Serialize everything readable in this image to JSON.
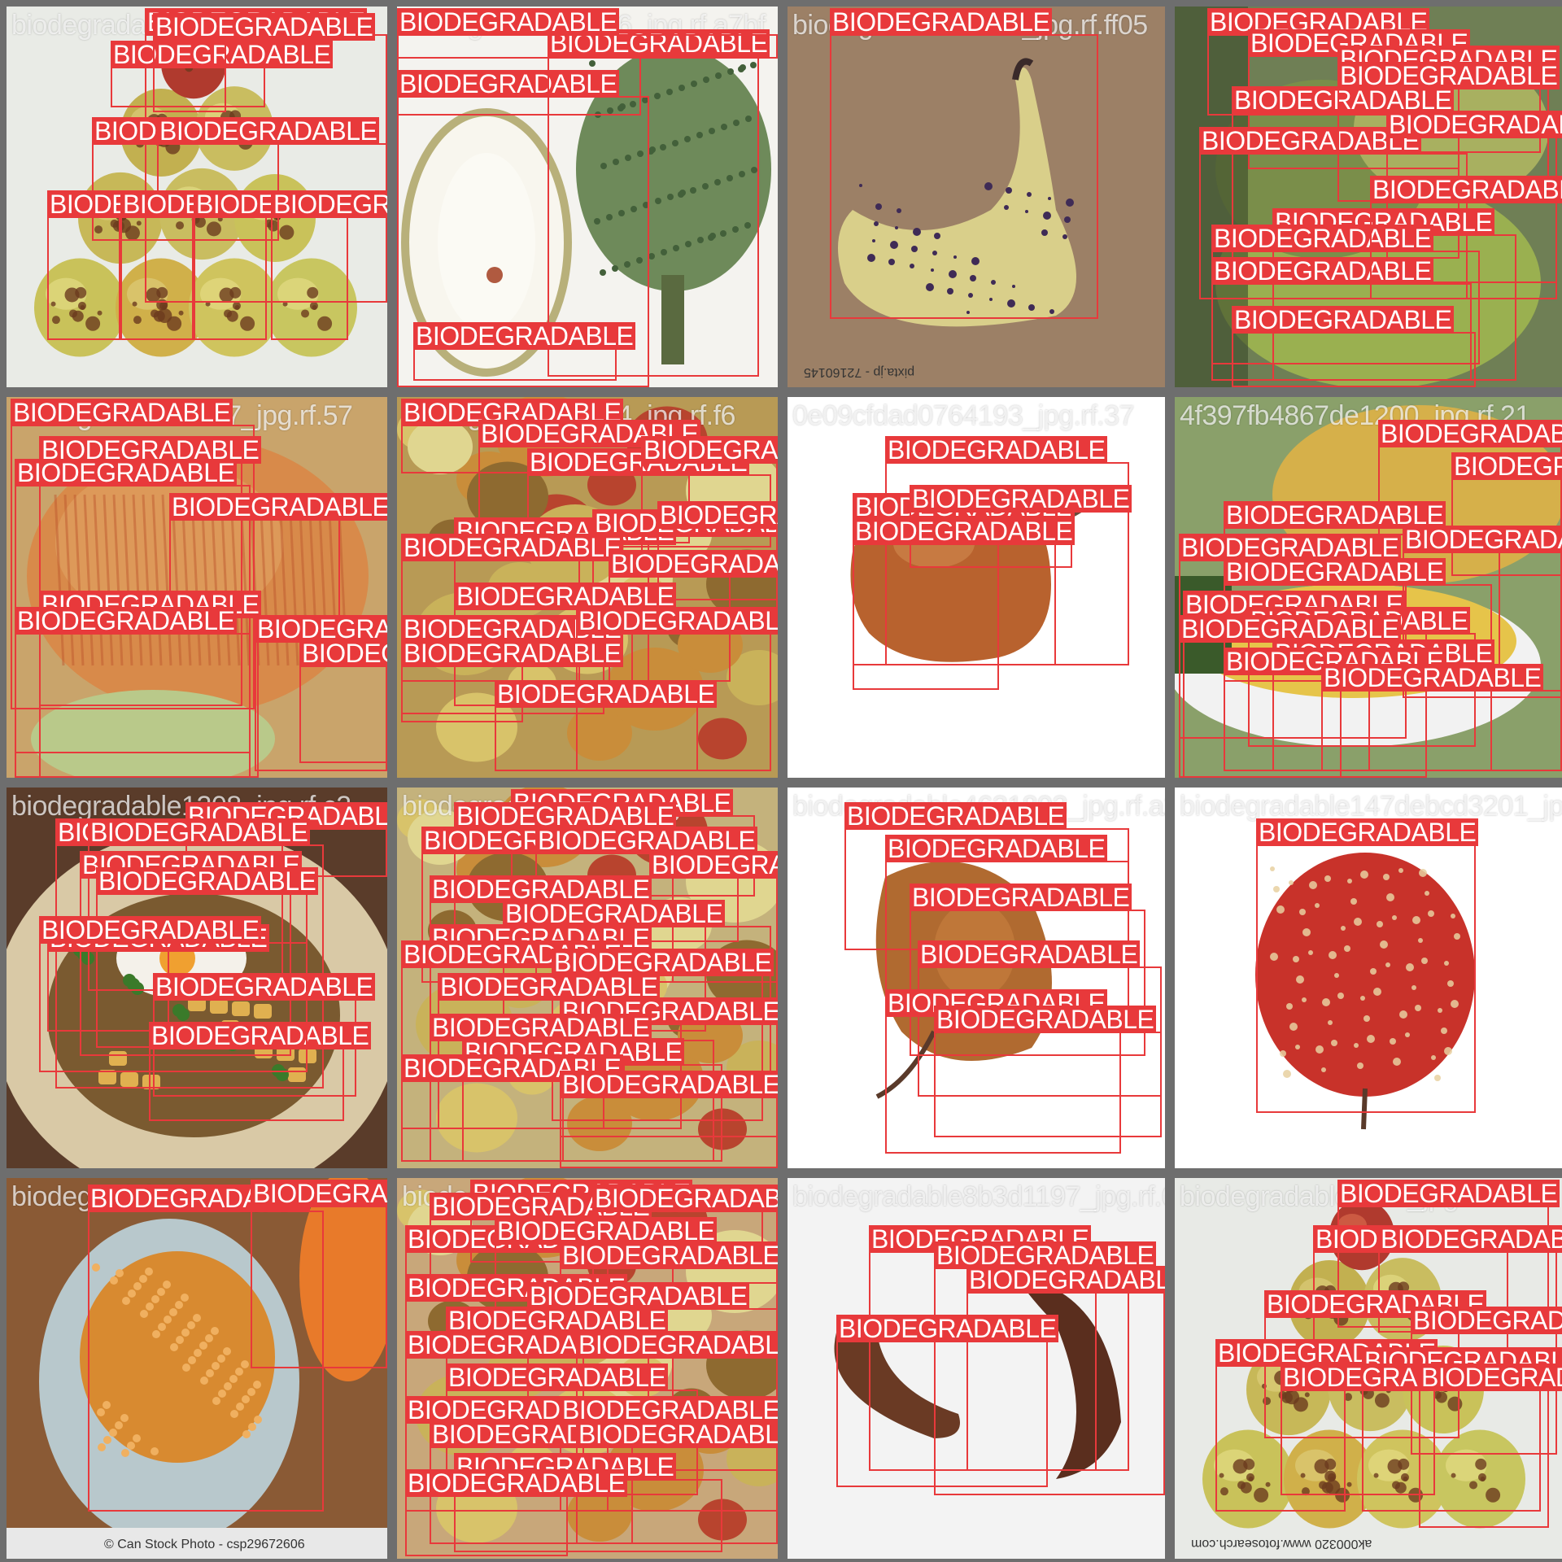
{
  "grid": {
    "rows": 4,
    "cols": 4,
    "background": "#6e6e6e",
    "box_color": "#e8393b"
  },
  "default_label": "BIODEGRADABLE",
  "tiles": [
    {
      "name": "tile-1",
      "filename": "biodegradable1205_jpg.rf.",
      "subject": "row-of-spotted-apples",
      "bg": "#e9ebe6",
      "watermark": "",
      "boxes": 9
    },
    {
      "name": "tile-2",
      "filename": "biodegradable1206_jpg.rf.a7bf",
      "subject": "durian-cut-open",
      "bg": "#f4f3ef",
      "watermark": "",
      "boxes": 5
    },
    {
      "name": "tile-3",
      "filename": "biodegradable1207_jpg.rf.ff05",
      "subject": "overripe-banana-on-wood",
      "bg": "#9c8066",
      "watermark": "pixta.jp - 72160145",
      "boxes": 1
    },
    {
      "name": "tile-4",
      "filename": "",
      "subject": "green-fruit-cluster",
      "bg": "#6f7f55",
      "watermark": "",
      "boxes": 12
    },
    {
      "name": "tile-5",
      "filename": "biodegradable1207_jpg.rf.57",
      "subject": "red-yellow-apple",
      "bg": "#c9a46b",
      "watermark": "",
      "boxes": 8
    },
    {
      "name": "tile-6",
      "filename": "biodegradable1234_jpg.rf.f6",
      "subject": "mixed-rotten-fruits",
      "bg": "#b89a55",
      "watermark": "",
      "boxes": 14
    },
    {
      "name": "tile-7",
      "filename": "0e09cfdad0764193_jpg.rf.37",
      "subject": "rotten-shrivelled-pear",
      "bg": "#ffffff",
      "watermark": "",
      "boxes": 4
    },
    {
      "name": "tile-8",
      "filename": "4f397fb4867de1200_jpg.rf.21",
      "subject": "bowl-of-fruit",
      "bg": "#8aa06a",
      "watermark": "",
      "boxes": 12
    },
    {
      "name": "tile-9",
      "filename": "biodegradable1208_jpg.rf.c2",
      "subject": "egg-and-potato-plate",
      "bg": "#5a3c2a",
      "watermark": "",
      "boxes": 9
    },
    {
      "name": "tile-10",
      "filename": "biodegradable1189_jpg.rf.",
      "subject": "many-fruits-pile",
      "bg": "#c4b27c",
      "watermark": "",
      "boxes": 16
    },
    {
      "name": "tile-11",
      "filename": "biodegradable4631893_jpg.rf.a2",
      "subject": "rotten-brown-pear",
      "bg": "#ffffff",
      "watermark": "",
      "boxes": 6
    },
    {
      "name": "tile-12",
      "filename": "biodegradable147debcd3201_jpg.rf.1e",
      "subject": "spotted-red-apple",
      "bg": "#ffffff",
      "watermark": "",
      "boxes": 1
    },
    {
      "name": "tile-13",
      "filename": "biodegradable1209_jpg.rf.dcb5",
      "subject": "moldy-orange",
      "bg": "#8a5a35",
      "watermark": "© Can Stock Photo - csp29672606",
      "boxes": 2
    },
    {
      "name": "tile-14",
      "filename": "biodegradable1210_jpg.rf.",
      "subject": "rotten-fruit-crate",
      "bg": "#c8a77a",
      "watermark": "",
      "boxes": 18
    },
    {
      "name": "tile-15",
      "filename": "biodegradable8b3d1197_jpg.rf.69",
      "subject": "two-rotten-bananas",
      "bg": "#f3f3f3",
      "watermark": "",
      "boxes": 4
    },
    {
      "name": "tile-16",
      "filename": "biodegradable1211_jpg.rf.",
      "subject": "pyramid-spotted-apples",
      "bg": "#e8eae6",
      "watermark": "ak000320 www.fotosearch.com",
      "boxes": 9
    }
  ]
}
